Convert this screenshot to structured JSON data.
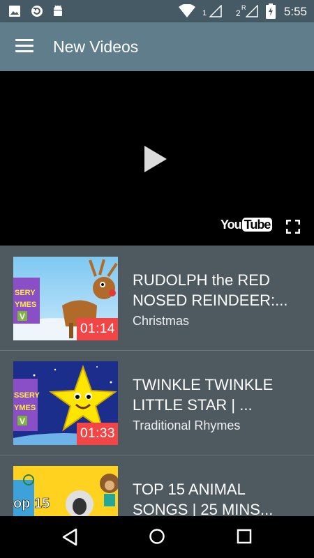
{
  "status_bar": {
    "time": "5:55",
    "sim1_label": "1",
    "sim2_label": "2",
    "sim2_roaming": "R",
    "battery_level": 0.9,
    "icons": [
      "image-icon",
      "sync-icon",
      "android-icon",
      "wifi-icon",
      "signal-icon",
      "signal-icon",
      "battery-charging-icon"
    ]
  },
  "app_bar": {
    "title": "New Videos",
    "menu_icon": "hamburger-menu-icon"
  },
  "player": {
    "play_icon": "play-icon",
    "logo_you": "You",
    "logo_tube": "Tube",
    "fullscreen_icon": "fullscreen-icon"
  },
  "videos": [
    {
      "title": "RUDOLPH the RED\nNOSED REINDEER:...",
      "category": "Christmas",
      "duration": "01:14"
    },
    {
      "title": "TWINKLE TWINKLE\nLITTLE STAR | ...",
      "category": "Traditional Rhymes",
      "duration": "01:33"
    },
    {
      "title": "TOP 15 ANIMAL\nSONGS | 25 MINS...",
      "category": "",
      "duration": ""
    }
  ],
  "thumb_text": {
    "thumb1_lines": [
      "SERY",
      "YMES",
      "V"
    ],
    "thumb2_lines": [
      "SSERY",
      "YMES",
      "V"
    ],
    "thumb3_line": "op 15"
  },
  "nav_bar": {
    "back_icon": "back-icon",
    "home_icon": "home-icon",
    "recents_icon": "recents-icon"
  },
  "colors": {
    "status_bar": "#455a64",
    "app_bar": "#607d8b",
    "list_bg": "#4e5a60",
    "duration_badge": "#f24646"
  }
}
